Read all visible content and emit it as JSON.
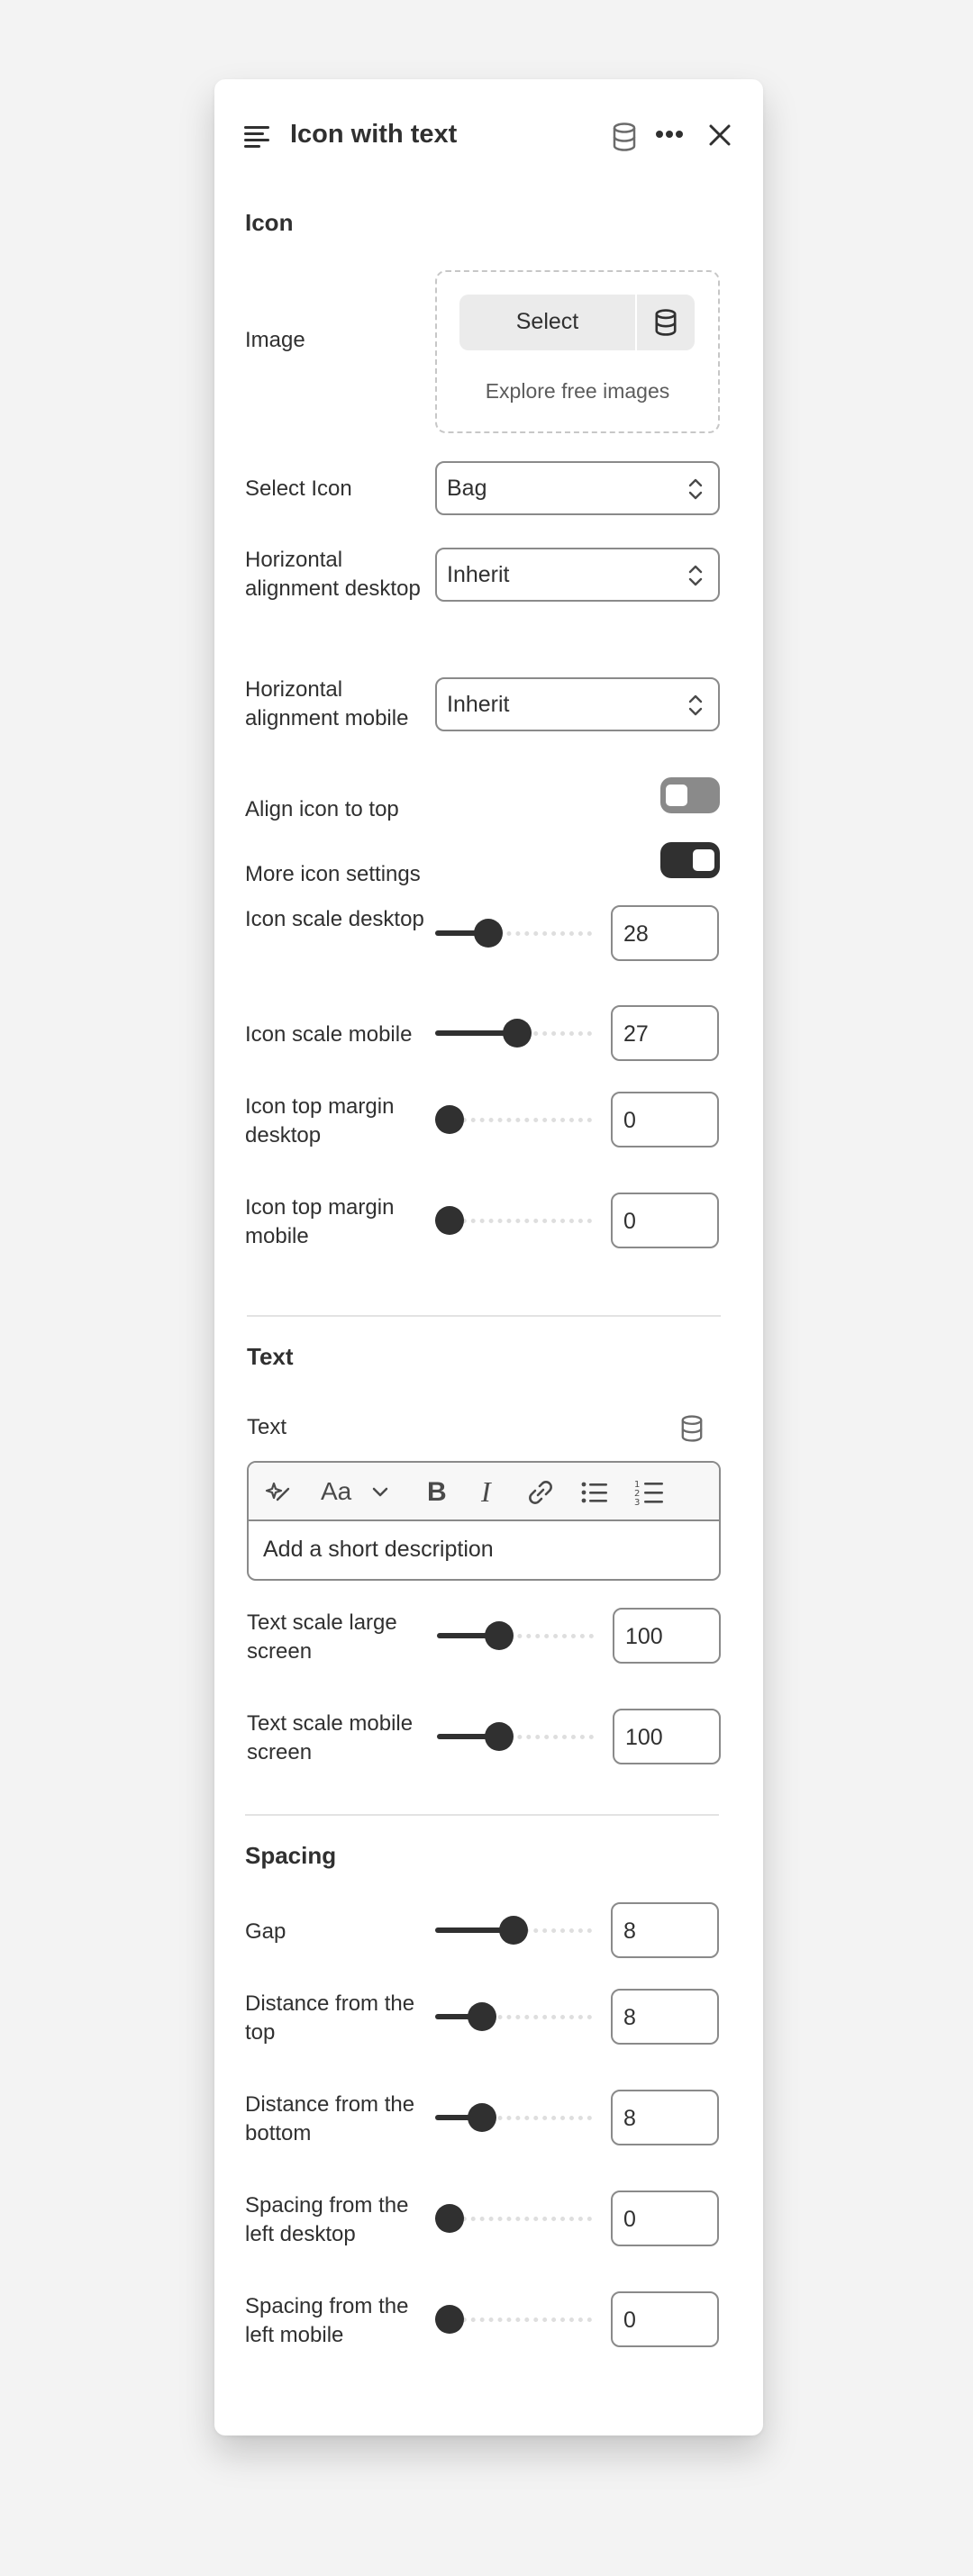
{
  "header": {
    "title": "Icon with text",
    "icons": [
      "menu-lines-icon",
      "database-icon",
      "more-horizontal-icon",
      "close-icon"
    ]
  },
  "icon_section": {
    "heading": "Icon",
    "image_label": "Image",
    "select_button": "Select",
    "explore_link": "Explore free images",
    "select_icon_label": "Select Icon",
    "select_icon_value": "Bag",
    "h_align_desktop_label": "Horizontal alignment desktop",
    "h_align_desktop_value": "Inherit",
    "h_align_mobile_label": "Horizontal alignment mobile",
    "h_align_mobile_value": "Inherit",
    "align_top_label": "Align icon to top",
    "align_top_on": false,
    "more_settings_label": "More icon settings",
    "more_settings_on": true,
    "sliders": [
      {
        "label": "Icon scale desktop",
        "value": "28",
        "fraction": 0.3
      },
      {
        "label": "Icon scale mobile",
        "value": "27",
        "fraction": 0.53
      },
      {
        "label": "Icon top margin desktop",
        "value": "0",
        "fraction": 0.0
      },
      {
        "label": "Icon top margin mobile",
        "value": "0",
        "fraction": 0.0
      }
    ]
  },
  "text_section": {
    "heading": "Text",
    "text_label": "Text",
    "editor_placeholder": "Add a short description",
    "toolbar": [
      "magic-icon",
      "font-size-icon",
      "chevron-down-icon",
      "bold-icon",
      "italic-icon",
      "link-icon",
      "bullet-list-icon",
      "numbered-list-icon"
    ],
    "sliders": [
      {
        "label": "Text scale large screen",
        "value": "100",
        "fraction": 0.37
      },
      {
        "label": "Text scale mobile screen",
        "value": "100",
        "fraction": 0.37
      }
    ]
  },
  "spacing_section": {
    "heading": "Spacing",
    "sliders": [
      {
        "label": "Gap",
        "value": "8",
        "fraction": 0.5
      },
      {
        "label": "Distance from the top",
        "value": "8",
        "fraction": 0.25
      },
      {
        "label": "Distance from the bottom",
        "value": "8",
        "fraction": 0.25
      },
      {
        "label": "Spacing from the left desktop",
        "value": "0",
        "fraction": 0.0
      },
      {
        "label": "Spacing from the left mobile",
        "value": "0",
        "fraction": 0.0
      }
    ]
  },
  "colors": {
    "accent": "#303030",
    "border": "#8a8a8a",
    "background": "#f3f3f3",
    "panel": "#ffffff"
  }
}
